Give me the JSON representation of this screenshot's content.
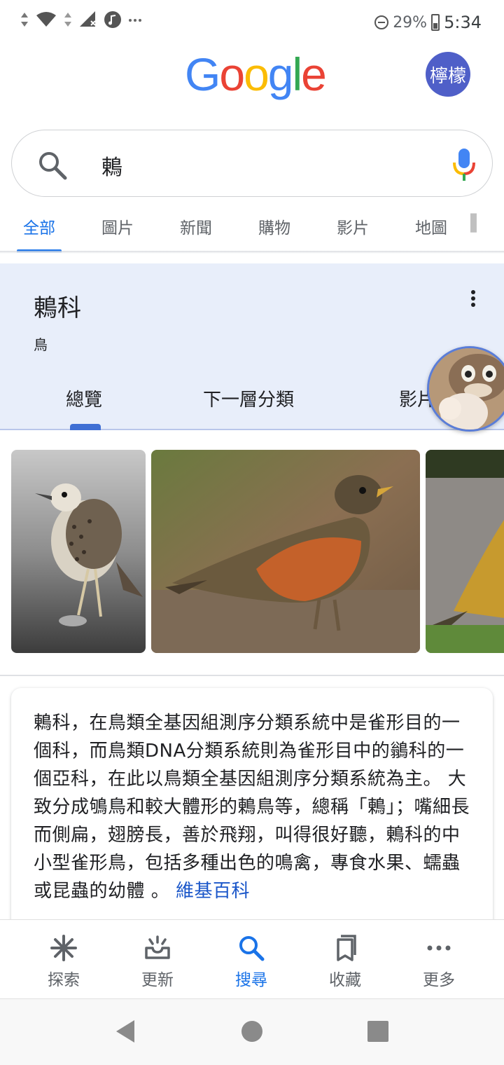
{
  "status_bar": {
    "battery": "29%",
    "time": "5:34"
  },
  "header": {
    "logo": "Google",
    "avatar_text": "檸檬"
  },
  "search": {
    "query": "鶇"
  },
  "tabs": [
    "全部",
    "圖片",
    "新聞",
    "購物",
    "影片",
    "地圖"
  ],
  "knowledge_card": {
    "title": "鶇科",
    "subtitle": "鳥",
    "tabs": [
      "總覽",
      "下一層分類",
      "影片"
    ]
  },
  "description": {
    "text": "鶇科，在鳥類全基因組測序分類系統中是雀形目的一個科，而鳥類DNA分類系統則為雀形目中的鶲科的一個亞科，在此以鳥類全基因組測序分類系統為主。 大致分成鴝鳥和較大體形的鶇鳥等，總稱「鶇」；嘴細長而側扁，翅膀長，善於飛翔，叫得很好聽，鶇科的中小型雀形鳥，包括多種出色的鳴禽，專食水果、蠕蟲或昆蟲的幼體 。",
    "source": "維基百科"
  },
  "bottom_nav": {
    "items": [
      {
        "label": "探索",
        "icon": "asterisk-icon"
      },
      {
        "label": "更新",
        "icon": "updates-tray-icon"
      },
      {
        "label": "搜尋",
        "icon": "search-icon"
      },
      {
        "label": "收藏",
        "icon": "collections-icon"
      },
      {
        "label": "更多",
        "icon": "more-dots-icon"
      }
    ],
    "active_index": 2
  },
  "colors": {
    "accent": "#1a73e8",
    "card_bg": "#e8eefa"
  }
}
